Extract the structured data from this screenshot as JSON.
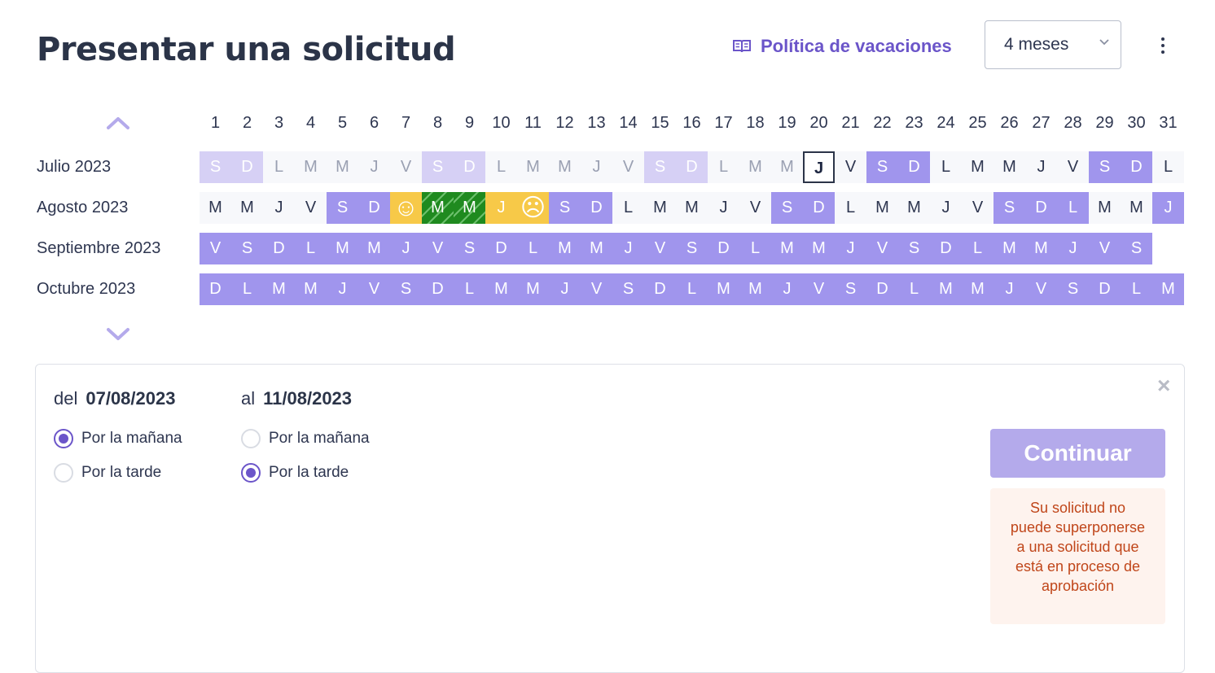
{
  "header": {
    "title": "Presentar una solicitud",
    "policy_link": "Política de vacaciones",
    "period_select": "4 meses"
  },
  "calendar": {
    "day_numbers": [
      "1",
      "2",
      "3",
      "4",
      "5",
      "6",
      "7",
      "8",
      "9",
      "10",
      "11",
      "12",
      "13",
      "14",
      "15",
      "16",
      "17",
      "18",
      "19",
      "20",
      "21",
      "22",
      "23",
      "24",
      "25",
      "26",
      "27",
      "28",
      "29",
      "30",
      "31"
    ],
    "rows": [
      {
        "label": "Julio 2023",
        "days": [
          {
            "l": "S",
            "s": "pastwe"
          },
          {
            "l": "D",
            "s": "pastwe"
          },
          {
            "l": "L",
            "s": "past"
          },
          {
            "l": "M",
            "s": "past"
          },
          {
            "l": "M",
            "s": "past"
          },
          {
            "l": "J",
            "s": "past"
          },
          {
            "l": "V",
            "s": "past"
          },
          {
            "l": "S",
            "s": "pastwe"
          },
          {
            "l": "D",
            "s": "pastwe"
          },
          {
            "l": "L",
            "s": "past"
          },
          {
            "l": "M",
            "s": "past"
          },
          {
            "l": "M",
            "s": "past"
          },
          {
            "l": "J",
            "s": "past"
          },
          {
            "l": "V",
            "s": "past"
          },
          {
            "l": "S",
            "s": "pastwe"
          },
          {
            "l": "D",
            "s": "pastwe"
          },
          {
            "l": "L",
            "s": "past"
          },
          {
            "l": "M",
            "s": "past"
          },
          {
            "l": "M",
            "s": "past"
          },
          {
            "l": "J",
            "s": "today"
          },
          {
            "l": "V",
            "s": "work"
          },
          {
            "l": "S",
            "s": "we"
          },
          {
            "l": "D",
            "s": "we"
          },
          {
            "l": "L",
            "s": "work"
          },
          {
            "l": "M",
            "s": "work"
          },
          {
            "l": "M",
            "s": "work"
          },
          {
            "l": "J",
            "s": "work"
          },
          {
            "l": "V",
            "s": "work"
          },
          {
            "l": "S",
            "s": "we"
          },
          {
            "l": "D",
            "s": "we"
          },
          {
            "l": "L",
            "s": "work"
          }
        ]
      },
      {
        "label": "Agosto 2023",
        "days": [
          {
            "l": "M",
            "s": "work"
          },
          {
            "l": "M",
            "s": "work"
          },
          {
            "l": "J",
            "s": "work"
          },
          {
            "l": "V",
            "s": "work"
          },
          {
            "l": "S",
            "s": "we"
          },
          {
            "l": "D",
            "s": "we"
          },
          {
            "l": "☺",
            "s": "approved",
            "e": "smile"
          },
          {
            "l": "M",
            "s": "pending"
          },
          {
            "l": "M",
            "s": "pending"
          },
          {
            "l": "J",
            "s": "approved"
          },
          {
            "l": "☹",
            "s": "approved",
            "e": "frown"
          },
          {
            "l": "S",
            "s": "we"
          },
          {
            "l": "D",
            "s": "we"
          },
          {
            "l": "L",
            "s": "work"
          },
          {
            "l": "M",
            "s": "work"
          },
          {
            "l": "M",
            "s": "work"
          },
          {
            "l": "J",
            "s": "work"
          },
          {
            "l": "V",
            "s": "work"
          },
          {
            "l": "S",
            "s": "we"
          },
          {
            "l": "D",
            "s": "we"
          },
          {
            "l": "L",
            "s": "work"
          },
          {
            "l": "M",
            "s": "work"
          },
          {
            "l": "M",
            "s": "work"
          },
          {
            "l": "J",
            "s": "work"
          },
          {
            "l": "V",
            "s": "work"
          },
          {
            "l": "S",
            "s": "we"
          },
          {
            "l": "D",
            "s": "we"
          },
          {
            "l": "L",
            "s": "we"
          },
          {
            "l": "M",
            "s": "work"
          },
          {
            "l": "M",
            "s": "work"
          },
          {
            "l": "J",
            "s": "we"
          }
        ]
      },
      {
        "label": "Septiembre 2023",
        "days": [
          {
            "l": "V",
            "s": "future"
          },
          {
            "l": "S",
            "s": "future"
          },
          {
            "l": "D",
            "s": "future"
          },
          {
            "l": "L",
            "s": "future"
          },
          {
            "l": "M",
            "s": "future"
          },
          {
            "l": "M",
            "s": "future"
          },
          {
            "l": "J",
            "s": "future"
          },
          {
            "l": "V",
            "s": "future"
          },
          {
            "l": "S",
            "s": "future"
          },
          {
            "l": "D",
            "s": "future"
          },
          {
            "l": "L",
            "s": "future"
          },
          {
            "l": "M",
            "s": "future"
          },
          {
            "l": "M",
            "s": "future"
          },
          {
            "l": "J",
            "s": "future"
          },
          {
            "l": "V",
            "s": "future"
          },
          {
            "l": "S",
            "s": "future"
          },
          {
            "l": "D",
            "s": "future"
          },
          {
            "l": "L",
            "s": "future"
          },
          {
            "l": "M",
            "s": "future"
          },
          {
            "l": "M",
            "s": "future"
          },
          {
            "l": "J",
            "s": "future"
          },
          {
            "l": "V",
            "s": "future"
          },
          {
            "l": "S",
            "s": "future"
          },
          {
            "l": "D",
            "s": "future"
          },
          {
            "l": "L",
            "s": "future"
          },
          {
            "l": "M",
            "s": "future"
          },
          {
            "l": "M",
            "s": "future"
          },
          {
            "l": "J",
            "s": "future"
          },
          {
            "l": "V",
            "s": "future"
          },
          {
            "l": "S",
            "s": "future"
          }
        ]
      },
      {
        "label": "Octubre 2023",
        "days": [
          {
            "l": "D",
            "s": "future"
          },
          {
            "l": "L",
            "s": "future"
          },
          {
            "l": "M",
            "s": "future"
          },
          {
            "l": "M",
            "s": "future"
          },
          {
            "l": "J",
            "s": "future"
          },
          {
            "l": "V",
            "s": "future"
          },
          {
            "l": "S",
            "s": "future"
          },
          {
            "l": "D",
            "s": "future"
          },
          {
            "l": "L",
            "s": "future"
          },
          {
            "l": "M",
            "s": "future"
          },
          {
            "l": "M",
            "s": "future"
          },
          {
            "l": "J",
            "s": "future"
          },
          {
            "l": "V",
            "s": "future"
          },
          {
            "l": "S",
            "s": "future"
          },
          {
            "l": "D",
            "s": "future"
          },
          {
            "l": "L",
            "s": "future"
          },
          {
            "l": "M",
            "s": "future"
          },
          {
            "l": "M",
            "s": "future"
          },
          {
            "l": "J",
            "s": "future"
          },
          {
            "l": "V",
            "s": "future"
          },
          {
            "l": "S",
            "s": "future"
          },
          {
            "l": "D",
            "s": "future"
          },
          {
            "l": "L",
            "s": "future"
          },
          {
            "l": "M",
            "s": "future"
          },
          {
            "l": "M",
            "s": "future"
          },
          {
            "l": "J",
            "s": "future"
          },
          {
            "l": "V",
            "s": "future"
          },
          {
            "l": "S",
            "s": "future"
          },
          {
            "l": "D",
            "s": "future"
          },
          {
            "l": "L",
            "s": "future"
          },
          {
            "l": "M",
            "s": "future"
          }
        ]
      }
    ]
  },
  "request": {
    "from_label": "del",
    "from_date": "07/08/2023",
    "to_label": "al",
    "to_date": "11/08/2023",
    "from_options": [
      {
        "label": "Por la mañana",
        "selected": true
      },
      {
        "label": "Por la tarde",
        "selected": false
      }
    ],
    "to_options": [
      {
        "label": "Por la mañana",
        "selected": false
      },
      {
        "label": "Por la tarde",
        "selected": true
      }
    ],
    "continue_label": "Continuar",
    "warning": "Su solicitud no puede superponerse a una solicitud que está en proceso de aprobación",
    "close_symbol": "×"
  },
  "colors": {
    "accent": "#6b55c9",
    "weekend": "#a095ed",
    "approved": "#f7c948",
    "pending": "#1f8a1f",
    "warning_text": "#c0461a"
  }
}
